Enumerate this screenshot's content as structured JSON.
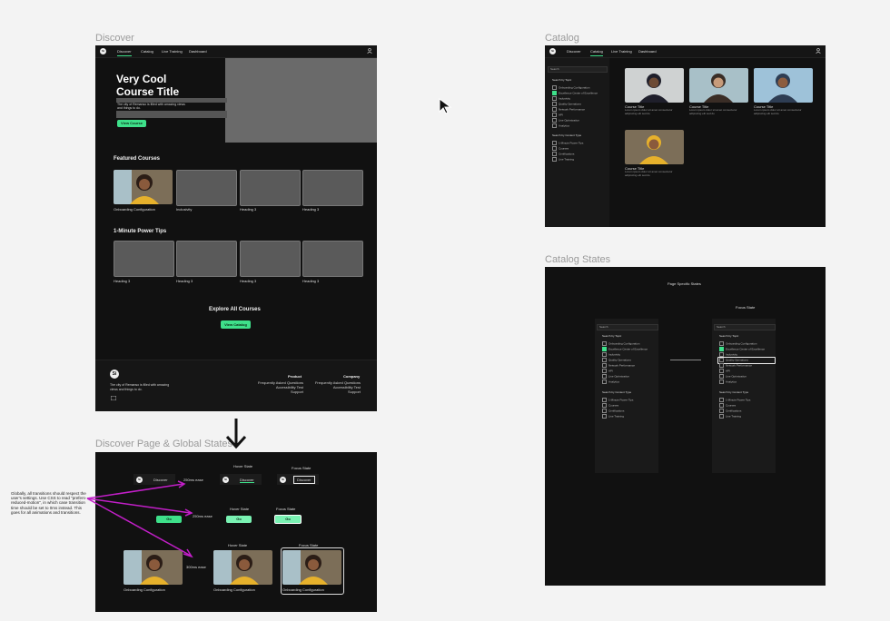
{
  "labels": {
    "discover": "Discover",
    "catalog": "Catalog",
    "catalog_states": "Catalog States",
    "discover_states": "Discover Page & Global States"
  },
  "nav": {
    "logo": "Si",
    "tabs": [
      "Discover",
      "Catalog",
      "Live Training",
      "Dashboard"
    ]
  },
  "hero": {
    "title_line1": "Very Cool",
    "title_line2": "Course Title",
    "description": "The city of Remanso is filled with amazing views and things to do.",
    "button": "View Course"
  },
  "featured": {
    "heading": "Featured Courses",
    "cards": [
      "Onboarding Configuration",
      "Inclusivity",
      "Heading 3",
      "Heading 3"
    ]
  },
  "power_tips": {
    "heading": "1-Minute Power Tips",
    "cards": [
      "Heading 3",
      "Heading 3",
      "Heading 3",
      "Heading 3"
    ]
  },
  "explore": {
    "heading": "Explore All Courses",
    "button": "View Catalog"
  },
  "footer": {
    "logo": "Si",
    "tagline": "The city of Remanso is filled with amazing views and things to do.",
    "product_heading": "Product",
    "product_links": [
      "Frequently Asked Questions",
      "Accessibility Test",
      "Support"
    ],
    "company_heading": "Company",
    "company_links": [
      "Frequently Asked Questions",
      "Accessibility Test",
      "Support"
    ]
  },
  "catalog": {
    "search_label": "Search",
    "topic_heading": "Search by Topic",
    "topics": [
      "Onboarding Configuration",
      "Excellence Center of Excellence",
      "Inclusivity",
      "Quality Operations",
      "Network Performance",
      "API",
      "Live Optimization",
      "Analytics"
    ],
    "topic_checked_index": 1,
    "content_heading": "Search by Content Type",
    "content_types": [
      "1-Minute Power Tips",
      "Courses",
      "Certifications",
      "Live Training"
    ],
    "courses": [
      {
        "title": "Course Title",
        "desc": "Lorem ipsum dolor sit amet consectetur adipiscing elit sed do"
      },
      {
        "title": "Course Title",
        "desc": "Lorem ipsum dolor sit amet consectetur adipiscing elit sed do"
      },
      {
        "title": "Course Title",
        "desc": "Lorem ipsum dolor sit amet consectetur adipiscing elit sed do"
      },
      {
        "title": "Course Title",
        "desc": "Lorem ipsum dolor sit amet consectetur adipiscing elit sed do"
      }
    ]
  },
  "catalog_states": {
    "page_title": "Page Specific States",
    "focus_state": "Focus State"
  },
  "global_states": {
    "hover_state": "Hover State",
    "focus_state": "Focus State",
    "nav_label": "Discover",
    "timing_250": "250ms ease",
    "timing_300": "300ms ease",
    "button_label": "Go",
    "card_label": "Onboarding Configuration"
  },
  "annotation": "Globally, all transitions should respect the user's settings. Use CSS to read \"prefers-reduced-motion\", in which case transition time should be set to 0ms instead. This goes for all animations and transitions.",
  "colors": {
    "accent": "#3ee08a",
    "canvas": "#f3f3f3",
    "frame": "#111111",
    "annotation_arrow": "#c21fc8"
  }
}
